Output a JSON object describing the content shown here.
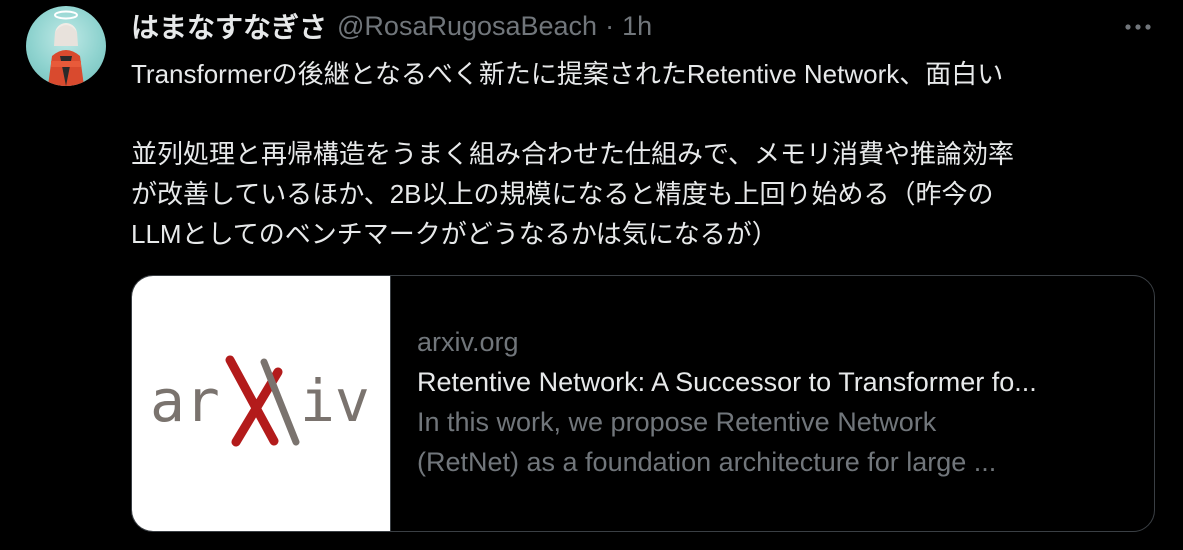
{
  "author": {
    "display_name": "はまなすなぎさ",
    "handle": "@RosaRugosaBeach",
    "separator": "·",
    "time": "1h"
  },
  "tweet": {
    "line1": "Transformerの後継となるべく新たに提案されたRetentive Network、面白い",
    "line2": "並列処理と再帰構造をうまく組み合わせた仕組みで、メモリ消費や推論効率",
    "line3": "が改善しているほか、2B以上の規模になると精度も上回り始める（昨今の",
    "line4": "LLMとしてのベンチマークがどうなるかは気になるが）"
  },
  "card": {
    "domain": "arxiv.org",
    "title": "Retentive Network: A Successor to Transformer fo...",
    "desc_line1": "In this work, we propose Retentive Network",
    "desc_line2": "(RetNet) as a foundation architecture for large ...",
    "logo_text": "arxiv"
  },
  "icons": {
    "more": "more-horizontal-icon",
    "avatar": "avatar"
  },
  "colors": {
    "background": "#000000",
    "primary_text": "#e7e9ea",
    "secondary_text": "#71767b",
    "border": "#3a3f44",
    "arxiv_red": "#b31b1b",
    "arxiv_gray": "#7a736e"
  }
}
